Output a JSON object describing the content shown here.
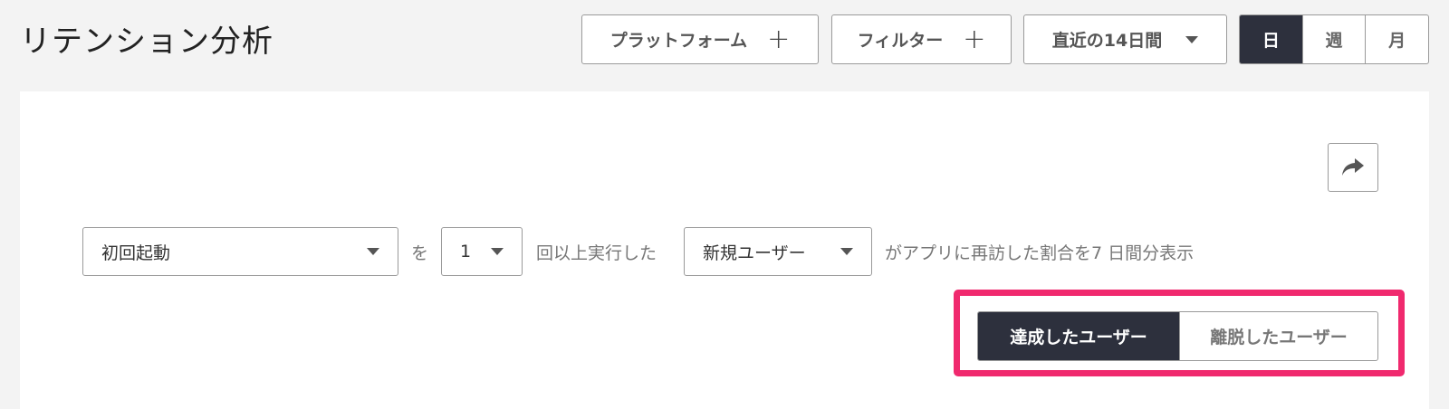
{
  "header": {
    "title": "リテンション分析",
    "platform_label": "プラットフォーム",
    "filter_label": "フィルター",
    "plus_symbol": "+",
    "range_label": "直近の14日間",
    "period": {
      "day": "日",
      "week": "週",
      "month": "月",
      "active": "day"
    }
  },
  "query": {
    "event_value": "初回起動",
    "wo": "を",
    "count_value": "1",
    "times_text": "回以上実行した",
    "user_type_value": "新規ユーザー",
    "suffix_text": "がアプリに再訪した割合を7 日間分表示"
  },
  "user_toggle": {
    "achieved_label": "達成したユーザー",
    "churned_label": "離脱したユーザー",
    "active": "achieved"
  },
  "colors": {
    "dark": "#2d303d",
    "highlight": "#f0296e",
    "background": "#f3f3f3"
  }
}
